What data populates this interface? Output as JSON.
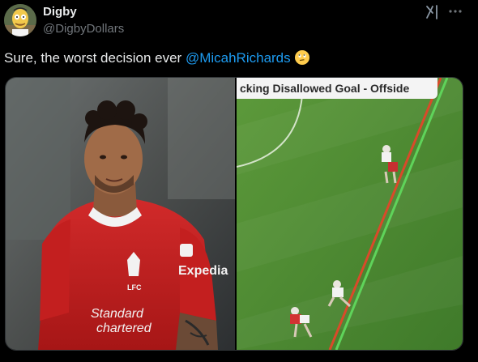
{
  "author": {
    "name": "Digby",
    "handle": "@DigbyDollars"
  },
  "icons": {
    "brand": "xai-grok-icon",
    "more": "more-horizontal-icon",
    "emoji": "thinking-face-emoji"
  },
  "tweet": {
    "text_before": "Sure, the worst decision ever ",
    "mention": "@MicahRichards",
    "emoji": "🙄"
  },
  "media": {
    "right_caption": "cking Disallowed Goal - Offside",
    "left_shirt_texts": [
      "Expedia",
      "LFC",
      "Standard",
      "Chartered"
    ]
  },
  "colors": {
    "background": "#000000",
    "text": "#e7e9ea",
    "muted": "#71767b",
    "mention": "#1d9bf0",
    "pitch_green": "#4f8a33",
    "offside_red": "#d94a2a",
    "offside_green": "#5fd35a"
  }
}
